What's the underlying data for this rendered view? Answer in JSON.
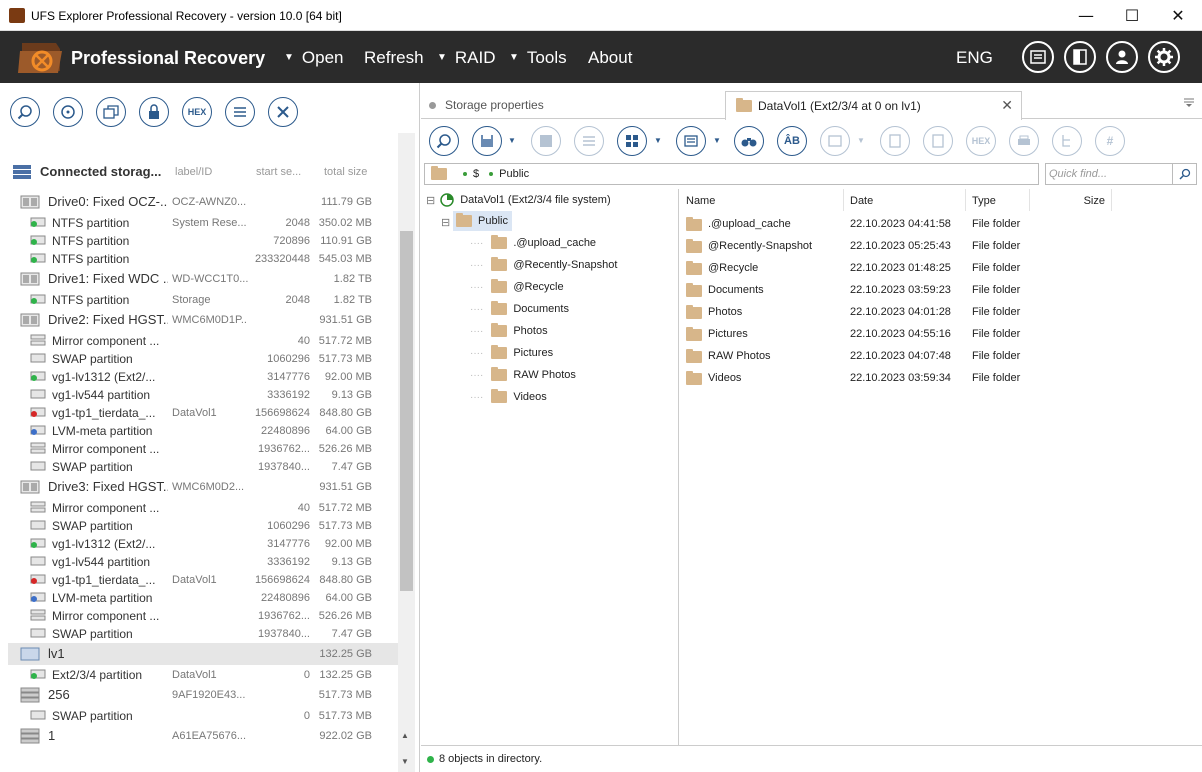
{
  "window": {
    "title": "UFS Explorer Professional Recovery - version 10.0 [64 bit]",
    "min_label": "—",
    "max_label": "☐",
    "close_label": "✕"
  },
  "menubar": {
    "brand": "Professional Recovery",
    "items": [
      {
        "label": "Open",
        "has_arrow": true
      },
      {
        "label": "Refresh",
        "has_arrow": false
      },
      {
        "label": "RAID",
        "has_arrow": true
      },
      {
        "label": "Tools",
        "has_arrow": true
      },
      {
        "label": "About",
        "has_arrow": false
      }
    ],
    "arrow_glyph": "▼",
    "language": "ENG",
    "accent_color": "#2b2b2b"
  },
  "left_toolbar": {
    "hex_label": "HEX"
  },
  "devices": {
    "header": {
      "title": "Connected storag...",
      "col_label": "label/ID",
      "col_start": "start se...",
      "col_total": "total size"
    },
    "rows": [
      {
        "type": "drive",
        "name": "Drive0: Fixed OCZ-...",
        "label": "OCZ-AWNZ0...",
        "start": "",
        "size": "111.79 GB"
      },
      {
        "type": "part",
        "name": "NTFS partition",
        "label": "System Rese...",
        "start": "2048",
        "size": "350.02 MB",
        "icon": "green"
      },
      {
        "type": "part",
        "name": "NTFS partition",
        "label": "",
        "start": "720896",
        "size": "110.91 GB",
        "icon": "green"
      },
      {
        "type": "part",
        "name": "NTFS partition",
        "label": "",
        "start": "233320448",
        "size": "545.03 MB",
        "icon": "green"
      },
      {
        "type": "drive",
        "name": "Drive1: Fixed WDC ...",
        "label": "WD-WCC1T0...",
        "start": "",
        "size": "1.82 TB"
      },
      {
        "type": "part",
        "name": "NTFS partition",
        "label": "Storage",
        "start": "2048",
        "size": "1.82 TB",
        "icon": "green"
      },
      {
        "type": "drive",
        "name": "Drive2: Fixed HGST...",
        "label": "WMC6M0D1P...",
        "start": "",
        "size": "931.51 GB"
      },
      {
        "type": "part",
        "name": "Mirror component ...",
        "label": "",
        "start": "40",
        "size": "517.72 MB",
        "icon": "mirror"
      },
      {
        "type": "part",
        "name": "SWAP partition",
        "label": "",
        "start": "1060296",
        "size": "517.73 MB",
        "icon": "gray"
      },
      {
        "type": "part",
        "name": "vg1-lv1312 (Ext2/...",
        "label": "",
        "start": "3147776",
        "size": "92.00 MB",
        "icon": "green"
      },
      {
        "type": "part",
        "name": "vg1-lv544 partition",
        "label": "",
        "start": "3336192",
        "size": "9.13 GB",
        "icon": "gray"
      },
      {
        "type": "part",
        "name": "vg1-tp1_tierdata_...",
        "label": "DataVol1",
        "start": "156698624",
        "size": "848.80 GB",
        "icon": "red"
      },
      {
        "type": "part",
        "name": "LVM-meta partition",
        "label": "",
        "start": "22480896",
        "size": "64.00 GB",
        "icon": "lvm"
      },
      {
        "type": "part",
        "name": "Mirror component ...",
        "label": "",
        "start": "1936762...",
        "size": "526.26 MB",
        "icon": "mirror"
      },
      {
        "type": "part",
        "name": "SWAP partition",
        "label": "",
        "start": "1937840...",
        "size": "7.47 GB",
        "icon": "gray"
      },
      {
        "type": "drive",
        "name": "Drive3: Fixed HGST...",
        "label": "WMC6M0D2...",
        "start": "",
        "size": "931.51 GB"
      },
      {
        "type": "part",
        "name": "Mirror component ...",
        "label": "",
        "start": "40",
        "size": "517.72 MB",
        "icon": "mirror"
      },
      {
        "type": "part",
        "name": "SWAP partition",
        "label": "",
        "start": "1060296",
        "size": "517.73 MB",
        "icon": "gray"
      },
      {
        "type": "part",
        "name": "vg1-lv1312 (Ext2/...",
        "label": "",
        "start": "3147776",
        "size": "92.00 MB",
        "icon": "green"
      },
      {
        "type": "part",
        "name": "vg1-lv544 partition",
        "label": "",
        "start": "3336192",
        "size": "9.13 GB",
        "icon": "gray"
      },
      {
        "type": "part",
        "name": "vg1-tp1_tierdata_...",
        "label": "DataVol1",
        "start": "156698624",
        "size": "848.80 GB",
        "icon": "red"
      },
      {
        "type": "part",
        "name": "LVM-meta partition",
        "label": "",
        "start": "22480896",
        "size": "64.00 GB",
        "icon": "lvm"
      },
      {
        "type": "part",
        "name": "Mirror component ...",
        "label": "",
        "start": "1936762...",
        "size": "526.26 MB",
        "icon": "mirror"
      },
      {
        "type": "part",
        "name": "SWAP partition",
        "label": "",
        "start": "1937840...",
        "size": "7.47 GB",
        "icon": "gray"
      },
      {
        "type": "drive",
        "name": "lv1",
        "label": "",
        "start": "",
        "size": "132.25 GB",
        "selected": true,
        "icon": "lv"
      },
      {
        "type": "part",
        "name": "Ext2/3/4 partition",
        "label": "DataVol1",
        "start": "0",
        "size": "132.25 GB",
        "icon": "green"
      },
      {
        "type": "drive",
        "name": "256",
        "label": "9AF1920E43...",
        "start": "",
        "size": "517.73 MB",
        "icon": "raid"
      },
      {
        "type": "part",
        "name": "SWAP partition",
        "label": "",
        "start": "0",
        "size": "517.73 MB",
        "icon": "gray"
      },
      {
        "type": "drive",
        "name": "1",
        "label": "A61EA75676...",
        "start": "",
        "size": "922.02 GB",
        "icon": "raid"
      }
    ]
  },
  "tabs": [
    {
      "label": "Storage properties",
      "active": false
    },
    {
      "label": "DataVol1 (Ext2/3/4 at 0 on lv1)",
      "active": true
    }
  ],
  "right_toolbar": {
    "hex_label": "HEX",
    "ab_label": "ÂB",
    "hash_label": "#"
  },
  "path": {
    "segments": [
      "$",
      "Public"
    ],
    "quick_find_placeholder": "Quick find..."
  },
  "tree": {
    "root": "DataVol1 (Ext2/3/4 file system)",
    "selected": "Public",
    "children": [
      ".@upload_cache",
      "@Recently-Snapshot",
      "@Recycle",
      "Documents",
      "Photos",
      "Pictures",
      "RAW Photos",
      "Videos"
    ],
    "collapse_glyph": "⊟"
  },
  "list": {
    "headers": {
      "name": "Name",
      "date": "Date",
      "type": "Type",
      "size": "Size"
    },
    "rows": [
      {
        "name": ".@upload_cache",
        "date": "22.10.2023 04:41:58",
        "type": "File folder",
        "size": ""
      },
      {
        "name": "@Recently-Snapshot",
        "date": "22.10.2023 05:25:43",
        "type": "File folder",
        "size": ""
      },
      {
        "name": "@Recycle",
        "date": "22.10.2023 01:48:25",
        "type": "File folder",
        "size": ""
      },
      {
        "name": "Documents",
        "date": "22.10.2023 03:59:23",
        "type": "File folder",
        "size": ""
      },
      {
        "name": "Photos",
        "date": "22.10.2023 04:01:28",
        "type": "File folder",
        "size": ""
      },
      {
        "name": "Pictures",
        "date": "22.10.2023 04:55:16",
        "type": "File folder",
        "size": ""
      },
      {
        "name": "RAW Photos",
        "date": "22.10.2023 04:07:48",
        "type": "File folder",
        "size": ""
      },
      {
        "name": "Videos",
        "date": "22.10.2023 03:59:34",
        "type": "File folder",
        "size": ""
      }
    ]
  },
  "status": {
    "text": "8 objects in directory."
  },
  "scroll": {
    "up_glyph": "▲",
    "down_glyph": "▼"
  }
}
